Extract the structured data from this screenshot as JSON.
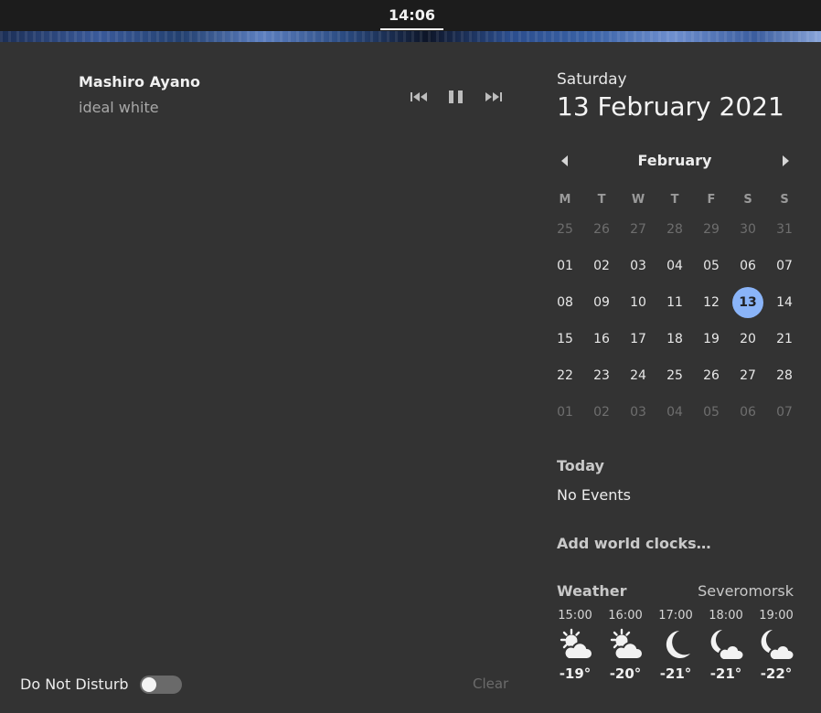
{
  "topbar": {
    "clock": "14:06"
  },
  "media": {
    "artist": "Mashiro Ayano",
    "track": "ideal white",
    "controls": [
      "previous-icon",
      "pause-icon",
      "next-icon"
    ]
  },
  "date": {
    "weekday": "Saturday",
    "full": "13 February 2021"
  },
  "calendar": {
    "month": "February",
    "weekdays": [
      "M",
      "T",
      "W",
      "T",
      "F",
      "S",
      "S"
    ],
    "weeks": [
      [
        {
          "d": "25",
          "dim": true
        },
        {
          "d": "26",
          "dim": true
        },
        {
          "d": "27",
          "dim": true
        },
        {
          "d": "28",
          "dim": true
        },
        {
          "d": "29",
          "dim": true
        },
        {
          "d": "30",
          "dim": true
        },
        {
          "d": "31",
          "dim": true
        }
      ],
      [
        {
          "d": "01"
        },
        {
          "d": "02"
        },
        {
          "d": "03"
        },
        {
          "d": "04"
        },
        {
          "d": "05"
        },
        {
          "d": "06"
        },
        {
          "d": "07"
        }
      ],
      [
        {
          "d": "08"
        },
        {
          "d": "09"
        },
        {
          "d": "10"
        },
        {
          "d": "11"
        },
        {
          "d": "12"
        },
        {
          "d": "13",
          "today": true
        },
        {
          "d": "14"
        }
      ],
      [
        {
          "d": "15"
        },
        {
          "d": "16"
        },
        {
          "d": "17"
        },
        {
          "d": "18"
        },
        {
          "d": "19"
        },
        {
          "d": "20"
        },
        {
          "d": "21"
        }
      ],
      [
        {
          "d": "22"
        },
        {
          "d": "23"
        },
        {
          "d": "24"
        },
        {
          "d": "25"
        },
        {
          "d": "26"
        },
        {
          "d": "27"
        },
        {
          "d": "28"
        }
      ],
      [
        {
          "d": "01",
          "dim": true
        },
        {
          "d": "02",
          "dim": true
        },
        {
          "d": "03",
          "dim": true
        },
        {
          "d": "04",
          "dim": true
        },
        {
          "d": "05",
          "dim": true
        },
        {
          "d": "06",
          "dim": true
        },
        {
          "d": "07",
          "dim": true
        }
      ]
    ],
    "accent": "#8ab4f8"
  },
  "events": {
    "title": "Today",
    "empty": "No Events"
  },
  "world_clocks": {
    "label": "Add world clocks…"
  },
  "weather": {
    "title": "Weather",
    "location": "Severomorsk",
    "forecast": [
      {
        "time": "15:00",
        "icon": "sun-cloud-icon",
        "temp": "-19°"
      },
      {
        "time": "16:00",
        "icon": "sun-cloud-icon",
        "temp": "-20°"
      },
      {
        "time": "17:00",
        "icon": "moon-icon",
        "temp": "-21°"
      },
      {
        "time": "18:00",
        "icon": "moon-cloud-icon",
        "temp": "-21°"
      },
      {
        "time": "19:00",
        "icon": "moon-cloud-icon",
        "temp": "-22°"
      }
    ]
  },
  "footer": {
    "dnd_label": "Do Not Disturb",
    "dnd_on": false,
    "clear_label": "Clear"
  }
}
